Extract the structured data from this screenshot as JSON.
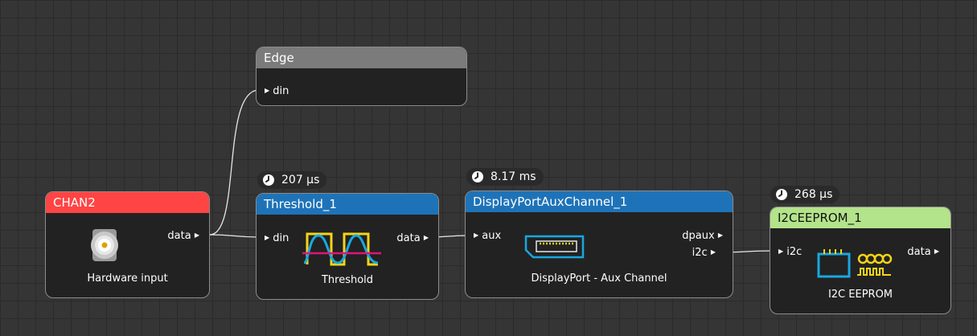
{
  "nodes": {
    "chan2": {
      "title": "CHAN2",
      "color": "#ff4444",
      "output": "data",
      "caption": "Hardware input",
      "icon": "bnc-connector-icon"
    },
    "edge": {
      "title": "Edge",
      "color": "#7b7b7b",
      "input": "din"
    },
    "threshold": {
      "title": "Threshold_1",
      "color": "#1e73b8",
      "input": "din",
      "output": "data",
      "caption": "Threshold",
      "timing": "207 µs",
      "icon": "threshold-waveform-icon"
    },
    "dpaux": {
      "title": "DisplayPortAuxChannel_1",
      "color": "#1e73b8",
      "input": "aux",
      "outputs": [
        "dpaux",
        "i2c"
      ],
      "caption": "DisplayPort - Aux Channel",
      "timing": "8.17 ms",
      "icon": "displayport-connector-icon"
    },
    "eeprom": {
      "title": "I2CEEPROM_1",
      "color": "#b3e38a",
      "input": "i2c",
      "output": "data",
      "caption": "I2C EEPROM",
      "timing": "268 µs",
      "icon": "eeprom-chip-icon"
    }
  },
  "colors": {
    "canvas": "#353535",
    "grid": "#2b2b2b",
    "node_body": "#222222",
    "node_border": "#8c8c8c",
    "wire": "#e6e6e6"
  }
}
